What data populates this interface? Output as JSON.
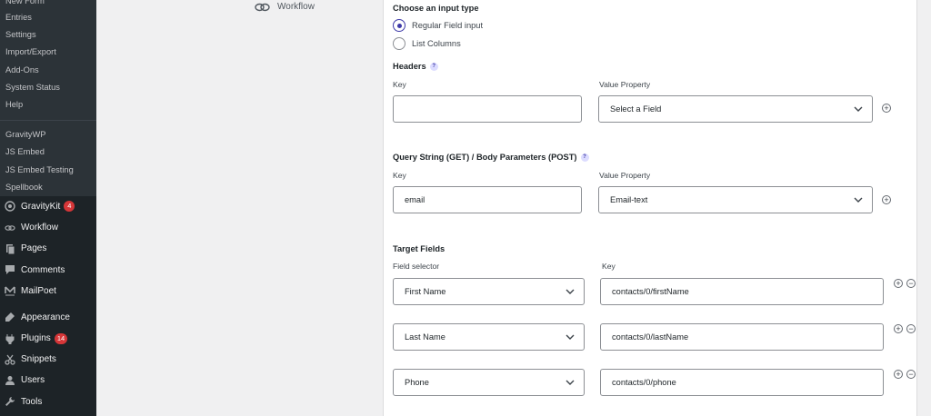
{
  "sidebar": {
    "forms_submenu": [
      "New Form",
      "Entries",
      "Settings",
      "Import/Export",
      "Add-Ons",
      "System Status",
      "Help"
    ],
    "plugins_submenu": [
      "GravityWP",
      "JS Embed",
      "JS Embed Testing",
      "Spellbook"
    ],
    "menu": [
      {
        "label": "GravityKit",
        "badge": "4",
        "icon": "gravitykit-icon"
      },
      {
        "label": "Workflow",
        "badge": null,
        "icon": "workflow-icon"
      },
      {
        "label": "Pages",
        "badge": null,
        "icon": "pages-icon"
      },
      {
        "label": "Comments",
        "badge": null,
        "icon": "comments-icon"
      },
      {
        "label": "MailPoet",
        "badge": null,
        "icon": "mailpoet-icon"
      },
      {
        "label": "Appearance",
        "badge": null,
        "icon": "appearance-icon"
      },
      {
        "label": "Plugins",
        "badge": "14",
        "icon": "plugins-icon"
      },
      {
        "label": "Snippets",
        "badge": null,
        "icon": "snippets-icon"
      },
      {
        "label": "Users",
        "badge": null,
        "icon": "users-icon"
      },
      {
        "label": "Tools",
        "badge": null,
        "icon": "tools-icon"
      }
    ]
  },
  "workflow_tab": {
    "label": "Workflow"
  },
  "input_type": {
    "title": "Choose an input type",
    "options": [
      "Regular Field input",
      "List Columns"
    ],
    "selected": "Regular Field input"
  },
  "headers": {
    "title": "Headers",
    "help": "?",
    "key_label": "Key",
    "value_label": "Value Property",
    "key_value": "",
    "value_selected": "Select a Field"
  },
  "query": {
    "title": "Query String (GET) / Body Parameters (POST)",
    "help": "?",
    "key_label": "Key",
    "value_label": "Value Property",
    "key_value": "email",
    "value_selected": "Email-text"
  },
  "target_fields": {
    "title": "Target Fields",
    "field_selector_label": "Field selector",
    "key_label": "Key",
    "rows": [
      {
        "field": "First Name",
        "key": "contacts/0/firstName"
      },
      {
        "field": "Last Name",
        "key": "contacts/0/lastName"
      },
      {
        "field": "Phone",
        "key": "contacts/0/phone"
      }
    ]
  },
  "buttons": {
    "add": "+",
    "remove": "−"
  },
  "colors": {
    "sidebar_bg": "#1d2327",
    "submenu_bg": "#2c3338",
    "badge": "#d63638",
    "accent": "#3e3aa8"
  }
}
